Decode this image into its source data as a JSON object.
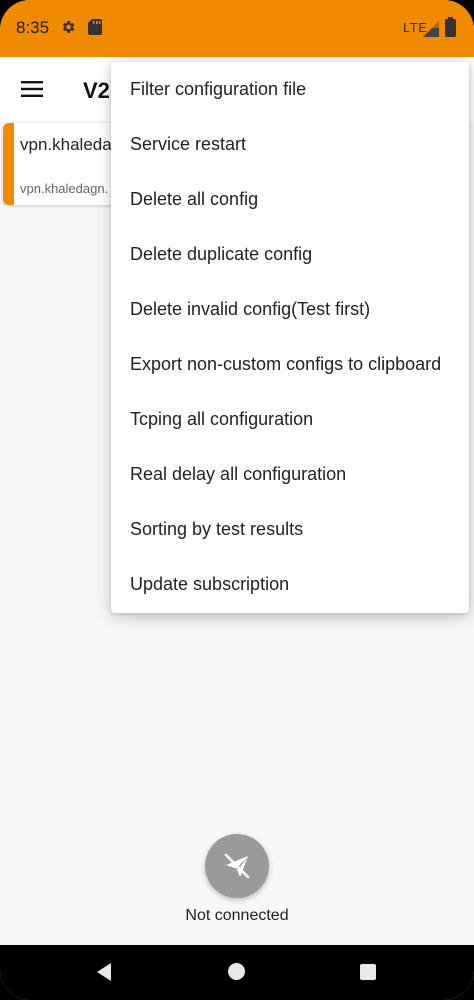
{
  "status_bar": {
    "time": "8:35",
    "network": "LTE",
    "icons": [
      "gear-icon",
      "sd-card-icon",
      "signal-icon",
      "battery-icon"
    ]
  },
  "app_bar": {
    "title": "V2",
    "menu_icon": "hamburger-menu-icon"
  },
  "server_card": {
    "title": "vpn.khaleda",
    "subtitle": "vpn.khaledagn."
  },
  "overflow_menu": {
    "items": [
      {
        "label": "Filter configuration file"
      },
      {
        "label": "Service restart"
      },
      {
        "label": "Delete all config"
      },
      {
        "label": "Delete duplicate config"
      },
      {
        "label": "Delete invalid config(Test first)"
      },
      {
        "label": "Export non-custom configs to clipboard"
      },
      {
        "label": "Tcping all configuration"
      },
      {
        "label": "Real delay all configuration"
      },
      {
        "label": "Sorting by test results"
      },
      {
        "label": "Update subscription"
      }
    ]
  },
  "connection": {
    "fab_icon": "disconnected-plane-icon",
    "status": "Not connected"
  },
  "colors": {
    "accent": "#f08a00",
    "fab": "#9a9a9a"
  }
}
